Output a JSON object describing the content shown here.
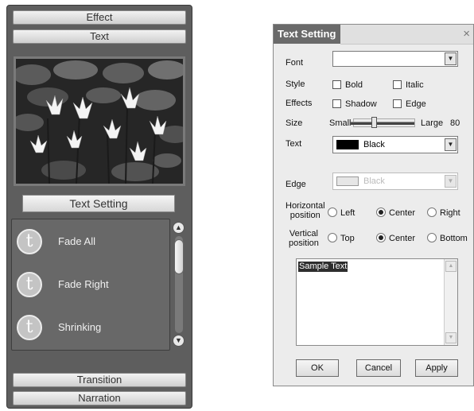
{
  "left_panel": {
    "tabs_top": [
      "Effect",
      "Text"
    ],
    "text_setting_button": "Text Setting",
    "effects": [
      {
        "icon": "t-circle-icon",
        "glyph": "t",
        "label": "Fade All"
      },
      {
        "icon": "t-circle-icon",
        "glyph": "t",
        "label": "Fade Right"
      },
      {
        "icon": "t-circle-icon",
        "glyph": "t",
        "label": "Shrinking"
      }
    ],
    "tabs_bottom": [
      "Transition",
      "Narration"
    ],
    "scroll_up_glyph": "▲",
    "scroll_down_glyph": "▼"
  },
  "dialog": {
    "title": "Text Setting",
    "close_glyph": "×",
    "font_label": "Font",
    "font_value": "",
    "style_label": "Style",
    "style_bold": "Bold",
    "style_italic": "Italic",
    "effects_label": "Effects",
    "effects_shadow": "Shadow",
    "effects_edge": "Edge",
    "size_label": "Size",
    "size_small": "Small",
    "size_large": "Large",
    "size_value": "80",
    "text_label": "Text",
    "text_color_name": "Black",
    "text_color_hex": "#000000",
    "edge_label": "Edge",
    "edge_color_name": "Black",
    "horizontal_label_1": "Horizontal",
    "horizontal_label_2": "position",
    "h_left": "Left",
    "h_center": "Center",
    "h_right": "Right",
    "h_selected": "Center",
    "vertical_label_1": "Vertical",
    "vertical_label_2": "position",
    "v_top": "Top",
    "v_center": "Center",
    "v_bottom": "Bottom",
    "v_selected": "Center",
    "sample_text": "Sample Text",
    "dropdown_glyph": "▼",
    "ok": "OK",
    "cancel": "Cancel",
    "apply": "Apply"
  }
}
